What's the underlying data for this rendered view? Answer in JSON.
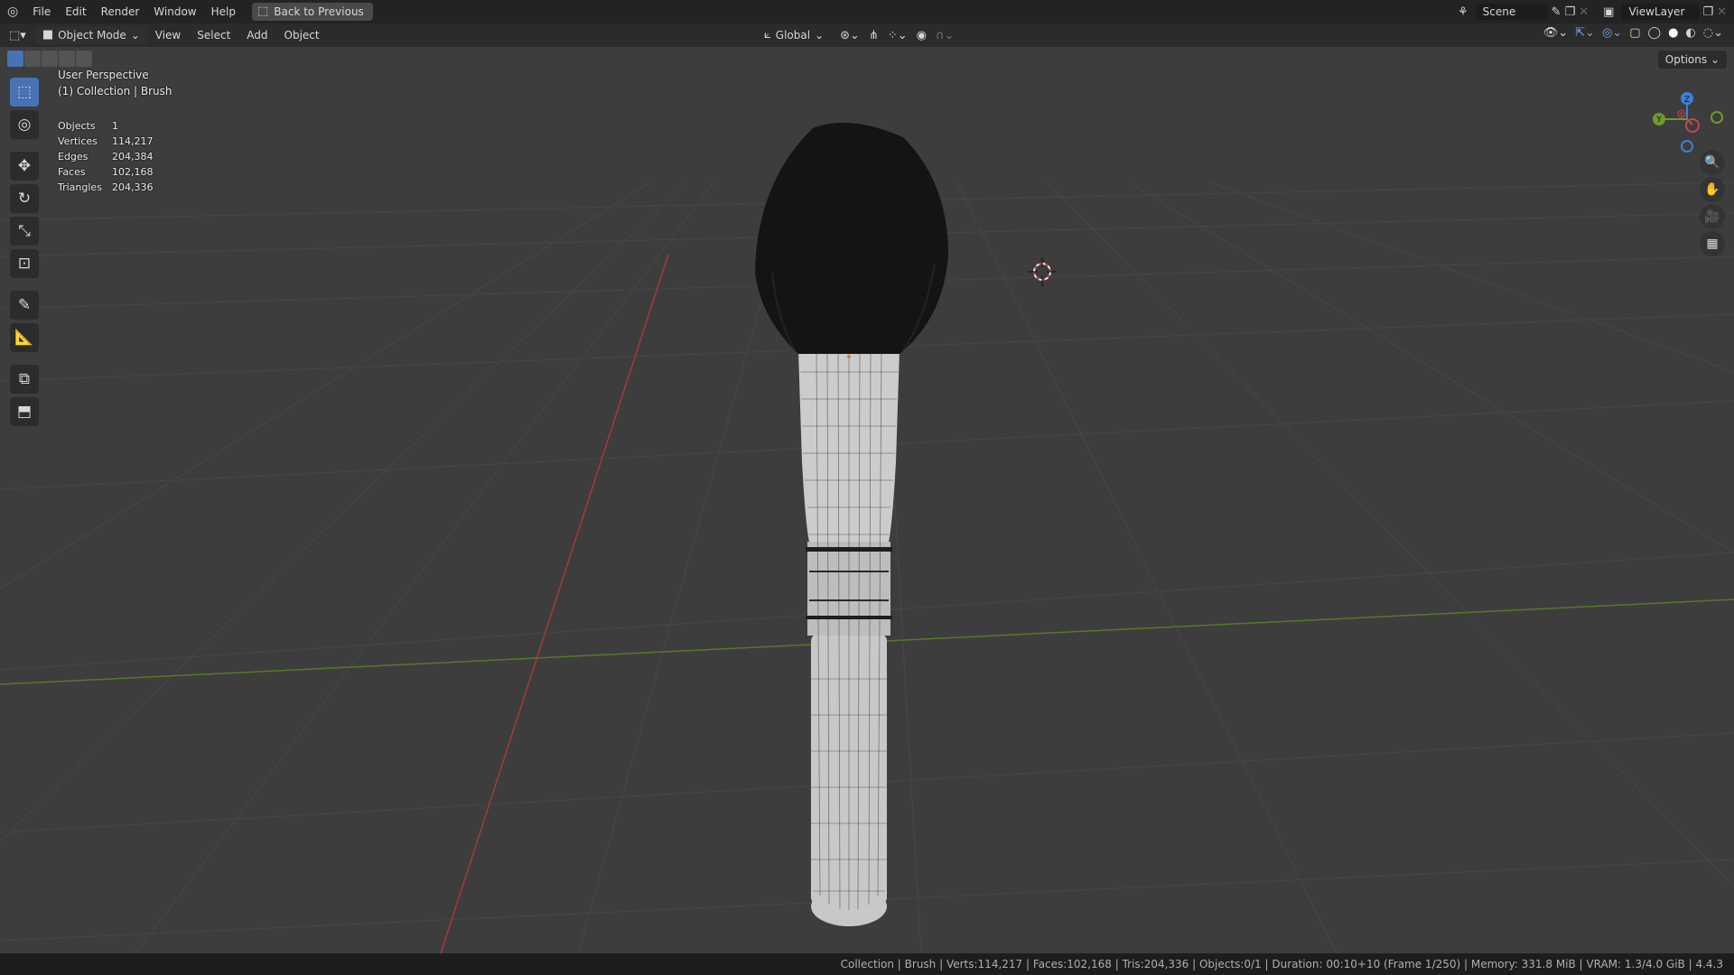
{
  "app": {
    "logo_icon": "blender-logo-icon"
  },
  "topbar": {
    "menus": [
      "File",
      "Edit",
      "Render",
      "Window",
      "Help"
    ],
    "back_label": "Back to Previous",
    "scene_label": "Scene",
    "viewlayer_label": "ViewLayer"
  },
  "header": {
    "mode_label": "Object Mode",
    "menus": [
      "View",
      "Select",
      "Add",
      "Object"
    ],
    "orientation_label": "Global"
  },
  "viewport": {
    "perspective_label": "User Perspective",
    "collection_label": "(1) Collection | Brush",
    "options_label": "Options",
    "stats": [
      {
        "label": "Objects",
        "value": "1"
      },
      {
        "label": "Vertices",
        "value": "114,217"
      },
      {
        "label": "Edges",
        "value": "204,384"
      },
      {
        "label": "Faces",
        "value": "102,168"
      },
      {
        "label": "Triangles",
        "value": "204,336"
      }
    ],
    "gizmo": {
      "z": "Z",
      "y": "Y",
      "x": "X"
    }
  },
  "statusbar": {
    "text": "Collection | Brush | Verts:114,217 | Faces:102,168 | Tris:204,336 | Objects:0/1 | Duration: 00:10+10 (Frame 1/250) | Memory: 331.8 MiB | VRAM: 1.3/4.0 GiB | 4.4.3"
  },
  "colors": {
    "accent": "#4772b3",
    "axis_x": "#c8464f",
    "axis_y": "#6d9a2a",
    "axis_z": "#3f7fd8"
  }
}
